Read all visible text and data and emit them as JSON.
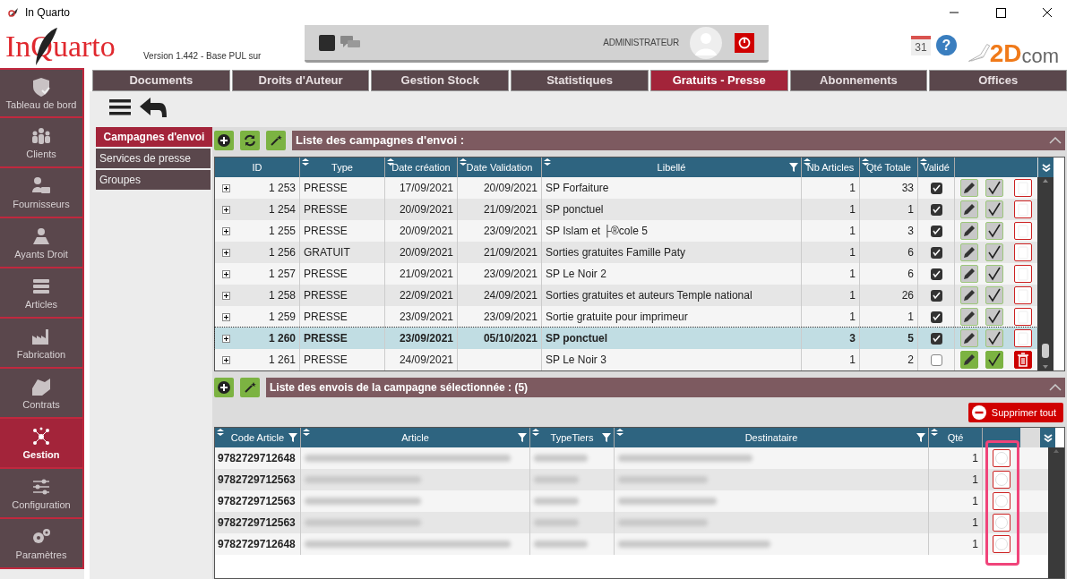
{
  "window": {
    "title": "In Quarto"
  },
  "header": {
    "logo": "InQuarto",
    "version": "Version 1.442 - Base PUL sur",
    "user": "ADMINISTRATEUR",
    "calendar_day": "31",
    "help": "?",
    "brand": {
      "main": "2D",
      "suffix": "com"
    }
  },
  "sidebar": {
    "items": [
      {
        "label": "Tableau de bord",
        "selected": false
      },
      {
        "label": "Clients",
        "selected": false
      },
      {
        "label": "Fournisseurs",
        "selected": false
      },
      {
        "label": "Ayants Droit",
        "selected": false
      },
      {
        "label": "Articles",
        "selected": false
      },
      {
        "label": "Fabrication",
        "selected": false
      },
      {
        "label": "Contrats",
        "selected": false
      },
      {
        "label": "Gestion",
        "selected": true
      },
      {
        "label": "Configuration",
        "selected": false
      },
      {
        "label": "Paramètres",
        "selected": false
      }
    ]
  },
  "tabs": [
    {
      "label": "Documents",
      "selected": false
    },
    {
      "label": "Droits d'Auteur",
      "selected": false
    },
    {
      "label": "Gestion Stock",
      "selected": false
    },
    {
      "label": "Statistiques",
      "selected": false
    },
    {
      "label": "Gratuits - Presse",
      "selected": true
    },
    {
      "label": "Abonnements",
      "selected": false
    },
    {
      "label": "Offices",
      "selected": false
    }
  ],
  "submenu": [
    {
      "label": "Campagnes d'envoi",
      "selected": true
    },
    {
      "label": "Services de presse",
      "selected": false
    },
    {
      "label": "Groupes",
      "selected": false
    }
  ],
  "campaigns": {
    "title": "Liste des campagnes d'envoi :",
    "columns": [
      {
        "label": "ID",
        "sortable": false,
        "filter": false
      },
      {
        "label": "Type",
        "sortable": true,
        "filter": false
      },
      {
        "label": "Date création",
        "sortable": true,
        "filter": false
      },
      {
        "label": "Date Validation",
        "sortable": true,
        "filter": false
      },
      {
        "label": "Libellé",
        "sortable": true,
        "filter": true
      },
      {
        "label": "Nb Articles",
        "sortable": true,
        "filter": false
      },
      {
        "label": "Qté Totale",
        "sortable": true,
        "filter": false
      },
      {
        "label": "Validé",
        "sortable": true,
        "filter": false
      }
    ],
    "rows": [
      {
        "id": "1 253",
        "type": "PRESSE",
        "date_creation": "17/09/2021",
        "date_validation": "20/09/2021",
        "libelle": "SP Forfaiture",
        "nb_articles": "1",
        "qte_totale": "33",
        "validated": true,
        "selected": false
      },
      {
        "id": "1 254",
        "type": "PRESSE",
        "date_creation": "20/09/2021",
        "date_validation": "21/09/2021",
        "libelle": "SP ponctuel",
        "nb_articles": "1",
        "qte_totale": "1",
        "validated": true,
        "selected": false
      },
      {
        "id": "1 255",
        "type": "PRESSE",
        "date_creation": "20/09/2021",
        "date_validation": "23/09/2021",
        "libelle": "SP Islam et ├®cole 5",
        "nb_articles": "1",
        "qte_totale": "3",
        "validated": true,
        "selected": false
      },
      {
        "id": "1 256",
        "type": "GRATUIT",
        "date_creation": "20/09/2021",
        "date_validation": "21/09/2021",
        "libelle": "Sorties gratuites Famille Paty",
        "nb_articles": "1",
        "qte_totale": "6",
        "validated": true,
        "selected": false
      },
      {
        "id": "1 257",
        "type": "PRESSE",
        "date_creation": "21/09/2021",
        "date_validation": "23/09/2021",
        "libelle": "SP Le Noir 2",
        "nb_articles": "1",
        "qte_totale": "6",
        "validated": true,
        "selected": false
      },
      {
        "id": "1 258",
        "type": "PRESSE",
        "date_creation": "22/09/2021",
        "date_validation": "24/09/2021",
        "libelle": "Sorties gratuites et auteurs Temple national",
        "nb_articles": "1",
        "qte_totale": "26",
        "validated": true,
        "selected": false
      },
      {
        "id": "1 259",
        "type": "PRESSE",
        "date_creation": "23/09/2021",
        "date_validation": "23/09/2021",
        "libelle": "Sortie gratuite pour imprimeur",
        "nb_articles": "1",
        "qte_totale": "1",
        "validated": true,
        "selected": false
      },
      {
        "id": "1 260",
        "type": "PRESSE",
        "date_creation": "23/09/2021",
        "date_validation": "05/10/2021",
        "libelle": "SP ponctuel",
        "nb_articles": "3",
        "qte_totale": "5",
        "validated": true,
        "selected": true
      },
      {
        "id": "1 261",
        "type": "PRESSE",
        "date_creation": "24/09/2021",
        "libelle": "SP Le Noir 3",
        "nb_articles": "1",
        "qte_totale": "2",
        "validated": false,
        "selected": false
      }
    ]
  },
  "shipments": {
    "title": "Liste des envois de la campagne sélectionnée : (5)",
    "delete_all": "Supprimer tout",
    "columns": [
      {
        "label": "Code Article",
        "filter": true
      },
      {
        "label": "Article",
        "filter": true
      },
      {
        "label": "TypeTiers",
        "filter": true
      },
      {
        "label": "Destinataire",
        "filter": true
      },
      {
        "label": "Qté",
        "filter": false
      }
    ],
    "rows": [
      {
        "code": "9782729712648",
        "qte": "1"
      },
      {
        "code": "9782729712563",
        "qte": "1"
      },
      {
        "code": "9782729712563",
        "qte": "1"
      },
      {
        "code": "9782729712563",
        "qte": "1"
      },
      {
        "code": "9782729712648",
        "qte": "1"
      }
    ]
  }
}
